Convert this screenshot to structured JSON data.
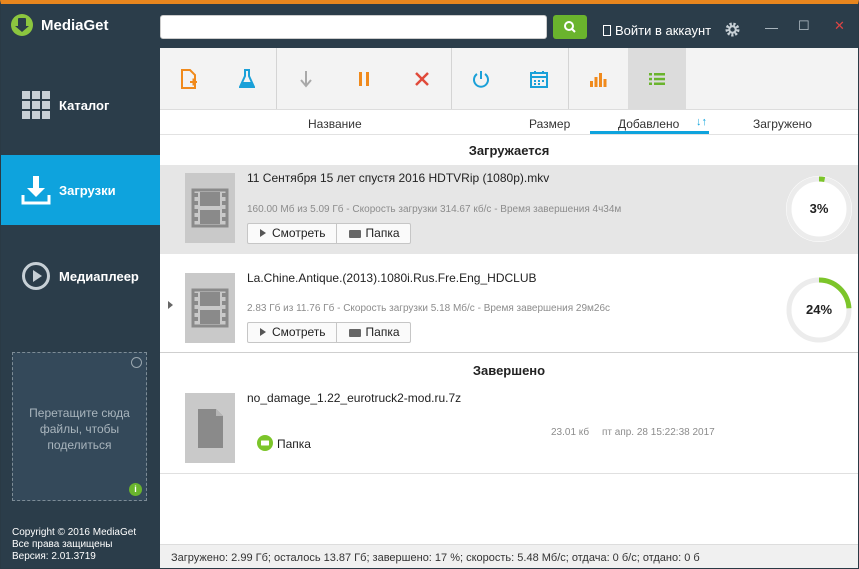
{
  "app": {
    "title": "MediaGet"
  },
  "header": {
    "search_placeholder": "",
    "login_label": "Войти в аккаунт"
  },
  "sidebar": {
    "items": [
      {
        "label": "Каталог",
        "icon": "grid-icon"
      },
      {
        "label": "Загрузки",
        "icon": "download-icon",
        "active": true
      },
      {
        "label": "Медиаплеер",
        "icon": "play-circle-icon"
      }
    ],
    "dropzone_text": "Перетащите сюда файлы, чтобы поделиться",
    "copyright": [
      "Copyright © 2016 MediaGet",
      "Все права защищены",
      "Версия: 2.01.3719"
    ]
  },
  "toolbar": {
    "buttons": [
      "add-torrent-icon",
      "flask-icon",
      "download-arrow-icon",
      "pause-icon",
      "delete-icon",
      "power-icon",
      "calendar-icon",
      "chart-icon",
      "list-icon"
    ]
  },
  "columns": {
    "name": "Название",
    "size": "Размер",
    "added": "Добавлено",
    "sort_icon": "↓↑",
    "downloaded": "Загружено"
  },
  "sections": {
    "downloading": "Загружается",
    "completed": "Завершено"
  },
  "downloads": [
    {
      "name": "11 Сентября 15 лет спустя 2016 HDTVRip (1080p).mkv",
      "meta": "160.00 Мб из 5.09 Гб - Скорость загрузки 314.67 кб/с - Время завершения 4ч34м",
      "progress_label": "3%",
      "progress": 0.03,
      "watch_label": "Смотреть",
      "folder_label": "Папка"
    },
    {
      "name": "La.Chine.Antique.(2013).1080i.Rus.Fre.Eng_HDCLUB",
      "meta": "2.83 Гб из 11.76 Гб - Скорость загрузки 5.18 Мб/с - Время завершения 29м26с",
      "progress_label": "24%",
      "progress": 0.24,
      "watch_label": "Смотреть",
      "folder_label": "Папка"
    }
  ],
  "completed": [
    {
      "name": "no_damage_1.22_eurotruck2-mod.ru.7z",
      "size": "23.01 кб",
      "date": "пт апр. 28 15:22:38 2017",
      "folder_label": "Папка"
    }
  ],
  "status": "Загружено: 2.99 Гб; осталось 13.87 Гб; завершено: 17 %; скорость: 5.48 Мб/с; отдача: 0 б/с; отдано: 0 б",
  "colors": {
    "accent": "#0ea3dd",
    "green": "#6ab42d",
    "dark": "#2b3d4a",
    "orange": "#e8861e"
  }
}
